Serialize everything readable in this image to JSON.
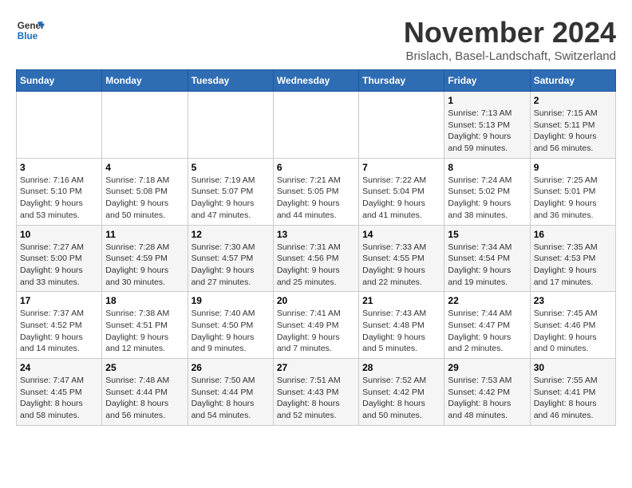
{
  "logo": {
    "line1": "General",
    "line2": "Blue"
  },
  "title": "November 2024",
  "subtitle": "Brislach, Basel-Landschaft, Switzerland",
  "headers": [
    "Sunday",
    "Monday",
    "Tuesday",
    "Wednesday",
    "Thursday",
    "Friday",
    "Saturday"
  ],
  "weeks": [
    [
      {
        "day": "",
        "info": ""
      },
      {
        "day": "",
        "info": ""
      },
      {
        "day": "",
        "info": ""
      },
      {
        "day": "",
        "info": ""
      },
      {
        "day": "",
        "info": ""
      },
      {
        "day": "1",
        "info": "Sunrise: 7:13 AM\nSunset: 5:13 PM\nDaylight: 9 hours and 59 minutes."
      },
      {
        "day": "2",
        "info": "Sunrise: 7:15 AM\nSunset: 5:11 PM\nDaylight: 9 hours and 56 minutes."
      }
    ],
    [
      {
        "day": "3",
        "info": "Sunrise: 7:16 AM\nSunset: 5:10 PM\nDaylight: 9 hours and 53 minutes."
      },
      {
        "day": "4",
        "info": "Sunrise: 7:18 AM\nSunset: 5:08 PM\nDaylight: 9 hours and 50 minutes."
      },
      {
        "day": "5",
        "info": "Sunrise: 7:19 AM\nSunset: 5:07 PM\nDaylight: 9 hours and 47 minutes."
      },
      {
        "day": "6",
        "info": "Sunrise: 7:21 AM\nSunset: 5:05 PM\nDaylight: 9 hours and 44 minutes."
      },
      {
        "day": "7",
        "info": "Sunrise: 7:22 AM\nSunset: 5:04 PM\nDaylight: 9 hours and 41 minutes."
      },
      {
        "day": "8",
        "info": "Sunrise: 7:24 AM\nSunset: 5:02 PM\nDaylight: 9 hours and 38 minutes."
      },
      {
        "day": "9",
        "info": "Sunrise: 7:25 AM\nSunset: 5:01 PM\nDaylight: 9 hours and 36 minutes."
      }
    ],
    [
      {
        "day": "10",
        "info": "Sunrise: 7:27 AM\nSunset: 5:00 PM\nDaylight: 9 hours and 33 minutes."
      },
      {
        "day": "11",
        "info": "Sunrise: 7:28 AM\nSunset: 4:59 PM\nDaylight: 9 hours and 30 minutes."
      },
      {
        "day": "12",
        "info": "Sunrise: 7:30 AM\nSunset: 4:57 PM\nDaylight: 9 hours and 27 minutes."
      },
      {
        "day": "13",
        "info": "Sunrise: 7:31 AM\nSunset: 4:56 PM\nDaylight: 9 hours and 25 minutes."
      },
      {
        "day": "14",
        "info": "Sunrise: 7:33 AM\nSunset: 4:55 PM\nDaylight: 9 hours and 22 minutes."
      },
      {
        "day": "15",
        "info": "Sunrise: 7:34 AM\nSunset: 4:54 PM\nDaylight: 9 hours and 19 minutes."
      },
      {
        "day": "16",
        "info": "Sunrise: 7:35 AM\nSunset: 4:53 PM\nDaylight: 9 hours and 17 minutes."
      }
    ],
    [
      {
        "day": "17",
        "info": "Sunrise: 7:37 AM\nSunset: 4:52 PM\nDaylight: 9 hours and 14 minutes."
      },
      {
        "day": "18",
        "info": "Sunrise: 7:38 AM\nSunset: 4:51 PM\nDaylight: 9 hours and 12 minutes."
      },
      {
        "day": "19",
        "info": "Sunrise: 7:40 AM\nSunset: 4:50 PM\nDaylight: 9 hours and 9 minutes."
      },
      {
        "day": "20",
        "info": "Sunrise: 7:41 AM\nSunset: 4:49 PM\nDaylight: 9 hours and 7 minutes."
      },
      {
        "day": "21",
        "info": "Sunrise: 7:43 AM\nSunset: 4:48 PM\nDaylight: 9 hours and 5 minutes."
      },
      {
        "day": "22",
        "info": "Sunrise: 7:44 AM\nSunset: 4:47 PM\nDaylight: 9 hours and 2 minutes."
      },
      {
        "day": "23",
        "info": "Sunrise: 7:45 AM\nSunset: 4:46 PM\nDaylight: 9 hours and 0 minutes."
      }
    ],
    [
      {
        "day": "24",
        "info": "Sunrise: 7:47 AM\nSunset: 4:45 PM\nDaylight: 8 hours and 58 minutes."
      },
      {
        "day": "25",
        "info": "Sunrise: 7:48 AM\nSunset: 4:44 PM\nDaylight: 8 hours and 56 minutes."
      },
      {
        "day": "26",
        "info": "Sunrise: 7:50 AM\nSunset: 4:44 PM\nDaylight: 8 hours and 54 minutes."
      },
      {
        "day": "27",
        "info": "Sunrise: 7:51 AM\nSunset: 4:43 PM\nDaylight: 8 hours and 52 minutes."
      },
      {
        "day": "28",
        "info": "Sunrise: 7:52 AM\nSunset: 4:42 PM\nDaylight: 8 hours and 50 minutes."
      },
      {
        "day": "29",
        "info": "Sunrise: 7:53 AM\nSunset: 4:42 PM\nDaylight: 8 hours and 48 minutes."
      },
      {
        "day": "30",
        "info": "Sunrise: 7:55 AM\nSunset: 4:41 PM\nDaylight: 8 hours and 46 minutes."
      }
    ]
  ]
}
